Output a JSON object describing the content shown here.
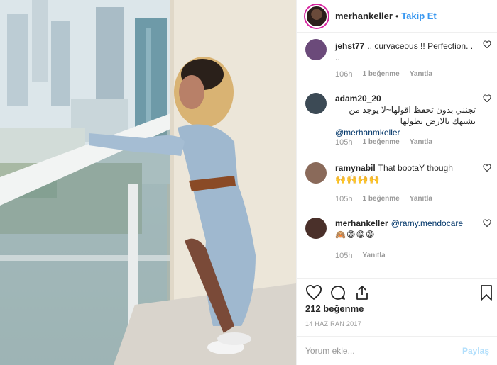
{
  "header": {
    "username": "merhankeller",
    "separator": "•",
    "follow_label": "Takip Et"
  },
  "comments": [
    {
      "username": "jehst77",
      "text": ".. curvaceous !! Perfection. . ..",
      "time": "106h",
      "likes": "1 beğenme",
      "reply": "Yanıtla",
      "avatar_color": "#6b4a7a"
    },
    {
      "username": "adam20_20",
      "text_rtl": "تجنني بدون تحفظ اقولها~لا يوجد من يشبهك بالارض بطولها",
      "mention": "@merhanmkeller",
      "time": "105h",
      "likes": "1 beğenme",
      "reply": "Yanıtla",
      "avatar_color": "#3c4a55"
    },
    {
      "username": "ramynabil",
      "text": "That bootaY though",
      "emojis": "🙌🙌🙌🙌",
      "time": "105h",
      "likes": "1 beğenme",
      "reply": "Yanıtla",
      "avatar_color": "#8a6a5a"
    },
    {
      "username": "merhankeller",
      "mention": "@ramy.mendocare",
      "emojis": "🙈😁😁😁",
      "time": "105h",
      "reply": "Yanıtla",
      "avatar_color": "#4a302a"
    }
  ],
  "actions": {
    "like_icon": "heart-icon",
    "comment_icon": "comment-icon",
    "share_icon": "share-icon",
    "save_icon": "bookmark-icon"
  },
  "post": {
    "likes_label": "212 beğenme",
    "date": "14 HAZİRAN 2017"
  },
  "add_comment": {
    "placeholder": "Yorum ekle...",
    "post_label": "Paylaş"
  },
  "colors": {
    "accent": "#3897f0",
    "text": "#262626",
    "muted": "#999999",
    "border": "#efefef"
  }
}
